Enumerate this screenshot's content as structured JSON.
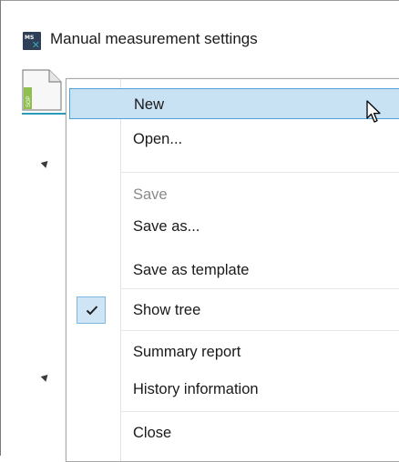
{
  "window": {
    "title": "Manual measurement settings",
    "icon": "ms-app-icon"
  },
  "toolbar": {
    "sop_icon_label": "SOP"
  },
  "menu": {
    "items": [
      {
        "label": "New",
        "state": "highlighted"
      },
      {
        "label": "Open...",
        "state": "normal"
      },
      {
        "label": "Save",
        "state": "disabled"
      },
      {
        "label": "Save as...",
        "state": "normal"
      },
      {
        "label": "Save as template",
        "state": "normal"
      },
      {
        "label": "Show tree",
        "state": "checked"
      },
      {
        "label": "Summary report",
        "state": "normal"
      },
      {
        "label": "History information",
        "state": "normal"
      },
      {
        "label": "Close",
        "state": "normal"
      }
    ]
  },
  "colors": {
    "highlight_bg": "#c8e1f3",
    "highlight_border": "#4da3d9",
    "accent_rule": "#2d99b8",
    "app_icon_bg": "#2e3f57"
  }
}
